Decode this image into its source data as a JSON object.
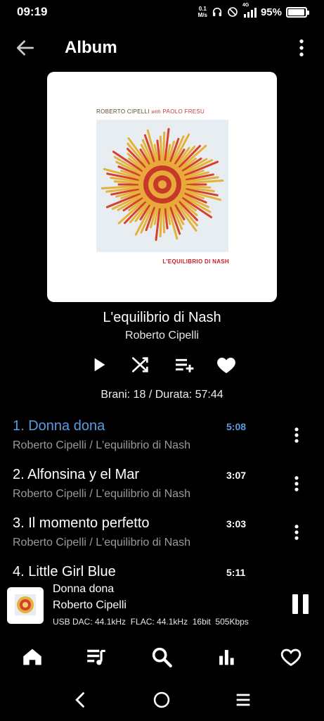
{
  "status_bar": {
    "time": "09:19",
    "net_speed_value": "0.1",
    "net_speed_unit": "M/s",
    "network_type": "4G",
    "battery": "95%",
    "battery_level": 0.95,
    "icons": [
      "headphones-icon",
      "do-not-disturb-icon",
      "signal-icon",
      "battery-icon"
    ]
  },
  "app_bar": {
    "title": "Album",
    "back_icon": "arrow-left-icon",
    "more_icon": "more-vertical-icon"
  },
  "album": {
    "cover_artist": "ROBERTO CIPELLI",
    "cover_with": "with",
    "cover_guest": "PAOLO FRESU",
    "cover_title": "L'EQUILIBRIO DI NASH",
    "title": "L'equilibrio di Nash",
    "artist": "Roberto Cipelli",
    "track_count": "Brani: 18 / Durata: 57:44"
  },
  "actions": [
    "play-icon",
    "shuffle-icon",
    "add-to-playlist-icon",
    "favorite-heart-icon"
  ],
  "tracks": [
    {
      "title": "1. Donna dona",
      "subtitle": "Roberto Cipelli / L'equilibrio di Nash",
      "duration": "5:08",
      "active": true
    },
    {
      "title": "2. Alfonsina y el Mar",
      "subtitle": "Roberto Cipelli / L'equilibrio di Nash",
      "duration": "3:07",
      "active": false
    },
    {
      "title": "3. Il momento perfetto",
      "subtitle": "Roberto Cipelli / L'equilibrio di Nash",
      "duration": "3:03",
      "active": false
    },
    {
      "title": "4. Little Girl Blue",
      "subtitle": "",
      "duration": "5:11",
      "active": false
    }
  ],
  "mini_player": {
    "title": "Donna dona",
    "artist": "Roberto Cipelli",
    "info": "USB DAC: 44.1kHz  FLAC: 44.1kHz  16bit  505Kbps"
  },
  "bottom_nav": [
    "home-icon",
    "queue-music-icon",
    "search-icon",
    "equalizer-icon",
    "favorites-heart-icon"
  ],
  "colors": {
    "accent": "#5b9be0",
    "background": "#000000",
    "subtitle": "#9a9a9a"
  }
}
